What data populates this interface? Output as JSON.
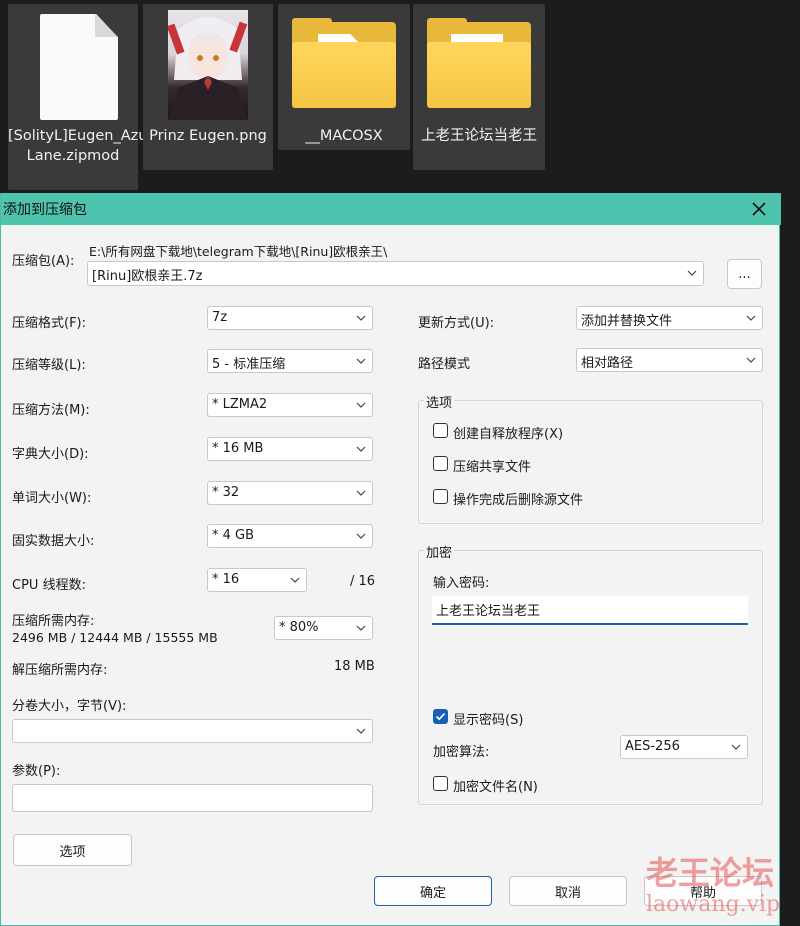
{
  "desktop": {
    "files": [
      {
        "label": "[SolityL]Eugen_Azur Lane.zipmod",
        "icon": "document-icon"
      },
      {
        "label": "Prinz Eugen.png",
        "icon": "image-thumbnail"
      },
      {
        "label": "__MACOSX",
        "icon": "folder-icon"
      },
      {
        "label": "上老王论坛当老王",
        "icon": "folder-icon"
      }
    ]
  },
  "dialog": {
    "title": "添加到压缩包",
    "archive": {
      "label": "压缩包(A):",
      "path": "E:\\所有网盘下载地\\telegram下载地\\[Rinu]欧根亲王\\",
      "name": "[Rinu]欧根亲王.7z",
      "browse_label": "..."
    },
    "left": {
      "format": {
        "label": "压缩格式(F):",
        "value": "7z"
      },
      "level": {
        "label": "压缩等级(L):",
        "value": "5 - 标准压缩"
      },
      "method": {
        "label": "压缩方法(M):",
        "value": "*  LZMA2"
      },
      "dict": {
        "label": "字典大小(D):",
        "value": "*  16 MB"
      },
      "word": {
        "label": "单词大小(W):",
        "value": "*  32"
      },
      "solid": {
        "label": "固实数据大小:",
        "value": "*  4 GB"
      },
      "threads": {
        "label": "CPU 线程数:",
        "value": "*  16",
        "max": "/ 16"
      },
      "mem_compress": {
        "label": "压缩所需内存:",
        "detail": "2496 MB / 12444 MB / 15555 MB",
        "value": "*  80%"
      },
      "mem_decompress": {
        "label": "解压缩所需内存:",
        "value": "18 MB"
      },
      "volume": {
        "label": "分卷大小，字节(V):",
        "value": ""
      },
      "params": {
        "label": "参数(P):",
        "value": ""
      },
      "options_button": "选项"
    },
    "right": {
      "update": {
        "label": "更新方式(U):",
        "value": "添加并替换文件"
      },
      "path_mode": {
        "label": "路径模式",
        "value": "相对路径"
      },
      "options": {
        "title": "选项",
        "sfx": {
          "label": "创建自释放程序(X)",
          "checked": false
        },
        "shared": {
          "label": "压缩共享文件",
          "checked": false
        },
        "delete": {
          "label": "操作完成后删除源文件",
          "checked": false
        }
      },
      "encryption": {
        "title": "加密",
        "password_label": "输入密码:",
        "password_value": "上老王论坛当老王",
        "show_password": {
          "label": "显示密码(S)",
          "checked": true
        },
        "algorithm_label": "加密算法:",
        "algorithm_value": "AES-256",
        "encrypt_names": {
          "label": "加密文件名(N)",
          "checked": false
        }
      }
    },
    "buttons": {
      "ok": "确定",
      "cancel": "取消",
      "help": "帮助"
    }
  },
  "watermark": {
    "cn": "老王论坛",
    "en": "laowang.vip"
  },
  "colors": {
    "titlebar": "#4ec3ad",
    "accent": "#1a5fb4",
    "folder": "#f5c542"
  }
}
